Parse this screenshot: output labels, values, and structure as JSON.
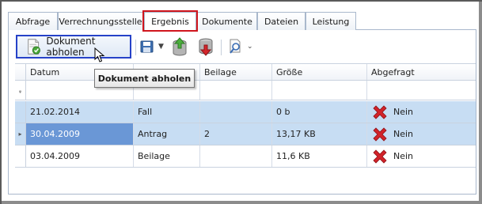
{
  "tabs": [
    {
      "label": "Abfrage"
    },
    {
      "label": "Verrechnungsstelle"
    },
    {
      "label": "Ergebnis"
    },
    {
      "label": "Dokumente"
    },
    {
      "label": "Dateien"
    },
    {
      "label": "Leistung"
    }
  ],
  "active_tab": "Ergebnis",
  "toolbar": {
    "fetch_document_label": "Dokument abholen"
  },
  "tooltip": {
    "text": "Dokument abholen"
  },
  "grid": {
    "columns": [
      "Datum",
      "",
      "Beilage",
      "Größe",
      "Abgefragt"
    ],
    "rows": [
      {
        "datum": "21.02.2014",
        "typ": "Fall",
        "beilage": "",
        "groesse": "0 b",
        "abgefragt": "Nein"
      },
      {
        "datum": "30.04.2009",
        "typ": "Antrag",
        "beilage": "2",
        "groesse": "13,17 KB",
        "abgefragt": "Nein"
      },
      {
        "datum": "03.04.2009",
        "typ": "Beilage",
        "beilage": "",
        "groesse": "11,6 KB",
        "abgefragt": "Nein"
      }
    ]
  },
  "colors": {
    "selection": "#c7ddf3",
    "focus_cell": "#6a97d6",
    "highlight_tab_border": "#d0151d",
    "highlight_button_border": "#2642c8",
    "no_icon": "#d2232a"
  }
}
